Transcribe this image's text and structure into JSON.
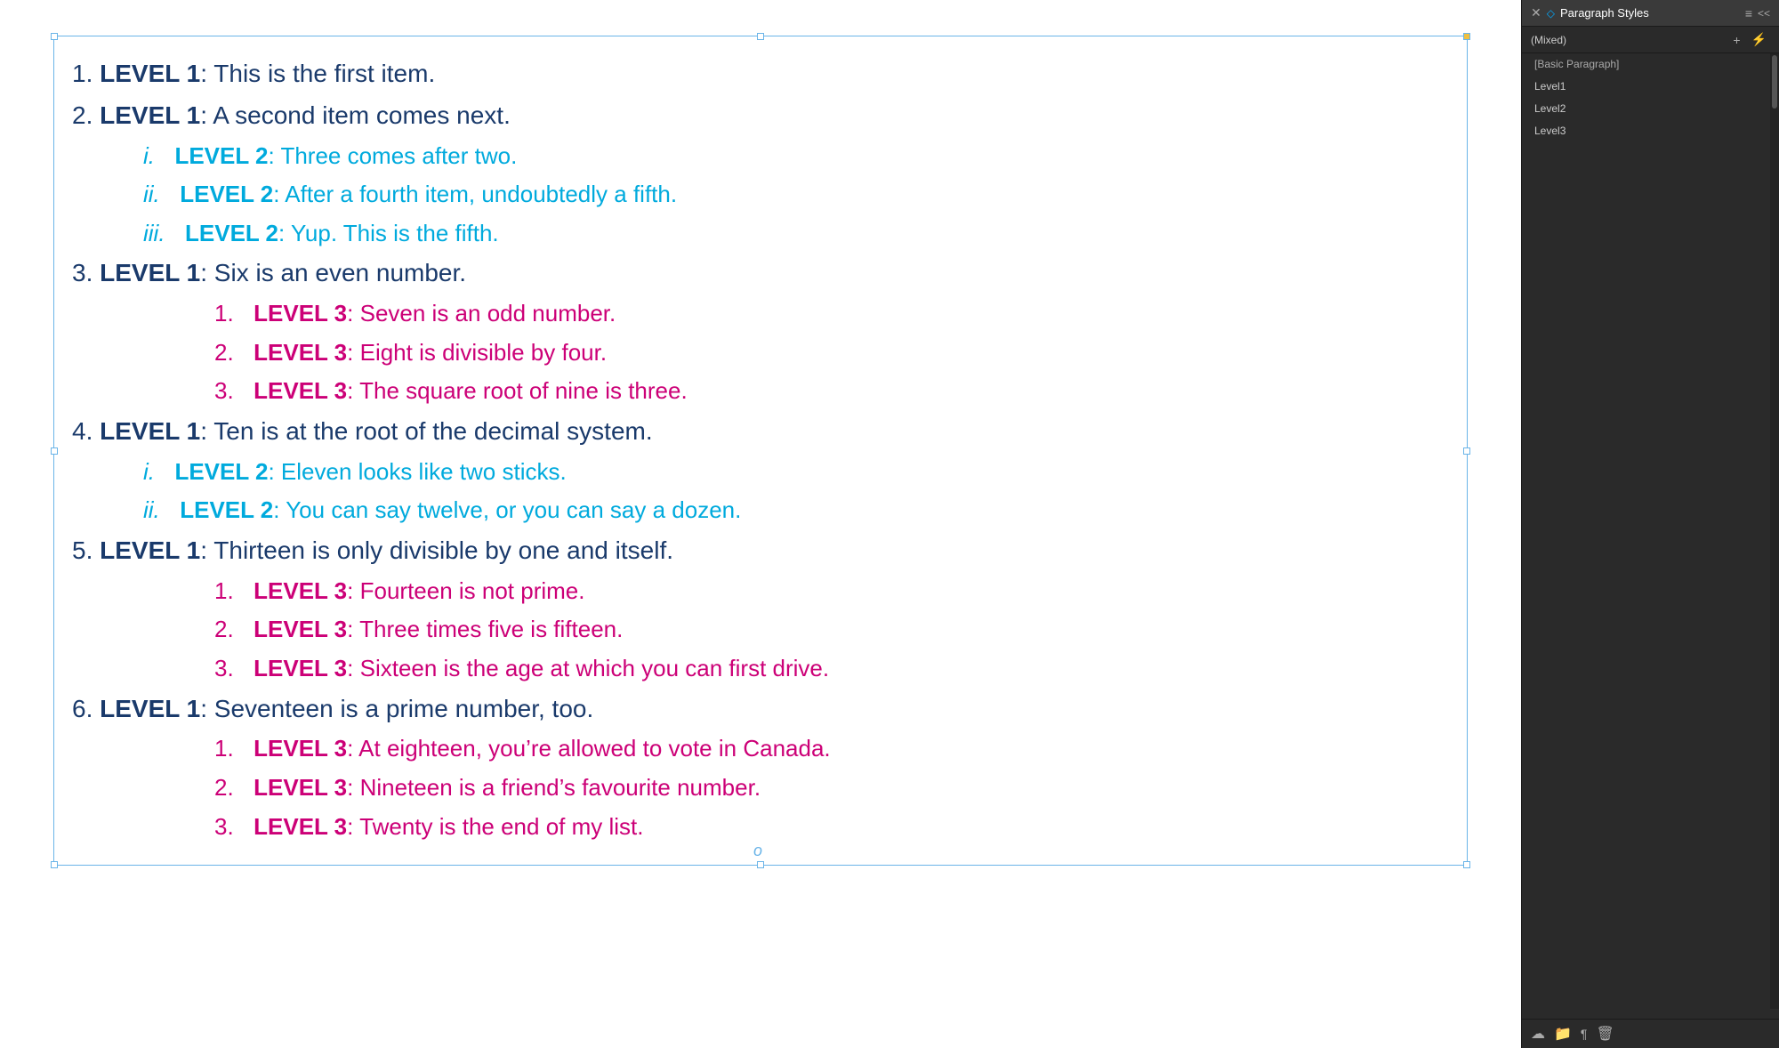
{
  "panel": {
    "close_label": "✕",
    "collapse_label": "◇",
    "title": "Paragraph Styles",
    "menu_icon": "≡",
    "double_arrow": "<<",
    "mixed_label": "(Mixed)",
    "add_icon": "+",
    "lightning_icon": "⚡",
    "styles": [
      {
        "id": "basic-paragraph",
        "label": "[Basic Paragraph]"
      },
      {
        "id": "level1",
        "label": "Level1"
      },
      {
        "id": "level2",
        "label": "Level2"
      },
      {
        "id": "level3",
        "label": "Level3"
      }
    ],
    "footer": {
      "cloud_icon": "☁",
      "folder_icon": "📁",
      "paragraph_icon": "¶",
      "delete_icon": "🗑"
    }
  },
  "content": {
    "items": [
      {
        "level": 1,
        "number": "1.",
        "label": "LEVEL 1",
        "text": ": This is the first item."
      },
      {
        "level": 1,
        "number": "2.",
        "label": "LEVEL 1",
        "text": ": A second item comes next."
      },
      {
        "level": 2,
        "numeral": "i.",
        "label": "LEVEL 2",
        "text": ": Three comes after two."
      },
      {
        "level": 2,
        "numeral": "ii.",
        "label": "LEVEL 2",
        "text": ": After a fourth item, undoubtedly a fifth."
      },
      {
        "level": 2,
        "numeral": "iii.",
        "label": "LEVEL 2",
        "text": ": Yup. This is the fifth."
      },
      {
        "level": 1,
        "number": "3.",
        "label": "LEVEL 1",
        "text": ": Six is an even number."
      },
      {
        "level": 3,
        "numeral": "1.",
        "label": "LEVEL 3",
        "text": ": Seven is an odd number."
      },
      {
        "level": 3,
        "numeral": "2.",
        "label": "LEVEL 3",
        "text": ": Eight is divisible by four."
      },
      {
        "level": 3,
        "numeral": "3.",
        "label": "LEVEL 3",
        "text": ": The square root of nine is three."
      },
      {
        "level": 1,
        "number": "4.",
        "label": "LEVEL 1",
        "text": ": Ten is at the root of the decimal system."
      },
      {
        "level": 2,
        "numeral": "i.",
        "label": "LEVEL 2",
        "text": ": Eleven looks like two sticks."
      },
      {
        "level": 2,
        "numeral": "ii.",
        "label": "LEVEL 2",
        "text": ": You can say twelve, or you can say a dozen."
      },
      {
        "level": 1,
        "number": "5.",
        "label": "LEVEL 1",
        "text": ": Thirteen is only divisible by one and itself."
      },
      {
        "level": 3,
        "numeral": "1.",
        "label": "LEVEL 3",
        "text": ": Fourteen is not prime."
      },
      {
        "level": 3,
        "numeral": "2.",
        "label": "LEVEL 3",
        "text": ": Three times five is fifteen."
      },
      {
        "level": 3,
        "numeral": "3.",
        "label": "LEVEL 3",
        "text": ": Sixteen is the age at which you can first drive."
      },
      {
        "level": 1,
        "number": "6.",
        "label": "LEVEL 1",
        "text": ": Seventeen is a prime number, too."
      },
      {
        "level": 3,
        "numeral": "1.",
        "label": "LEVEL 3",
        "text": ": At eighteen, you’re allowed to vote in Canada."
      },
      {
        "level": 3,
        "numeral": "2.",
        "label": "LEVEL 3",
        "text": ": Nineteen is a friend’s favourite number."
      },
      {
        "level": 3,
        "numeral": "3.",
        "label": "LEVEL 3",
        "text": ": Twenty is the end of my list."
      }
    ]
  }
}
